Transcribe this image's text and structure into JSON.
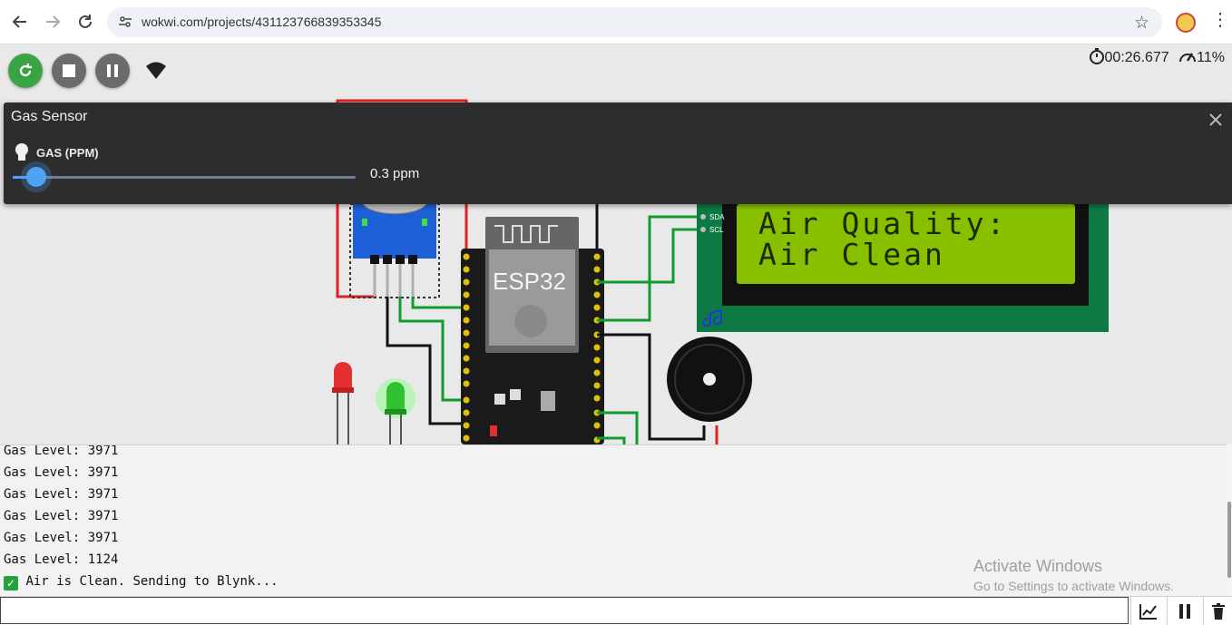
{
  "browser": {
    "url": "wokwi.com/projects/431123766839353345"
  },
  "sim": {
    "timer": "00:26.677",
    "speed": "11%",
    "chip_label": "ESP32",
    "lcd_line1": "Air Quality:",
    "lcd_line2": "Air Clean",
    "lcd_pin_sda": "SDA",
    "lcd_pin_scl": "SCL",
    "colors": {
      "lcd_green": "#88c000",
      "board_green": "#0e7a43",
      "restart_green": "#3aa445"
    }
  },
  "panel": {
    "title": "Gas Sensor",
    "control_label": "GAS (PPM)",
    "value_text": "0.3 ppm",
    "slider_fraction": 0.07
  },
  "console": {
    "lines": [
      "Gas Level: 3971",
      "Gas Level: 3971",
      "Gas Level: 3971",
      "Gas Level: 3971",
      "Gas Level: 3971",
      "Gas Level: 1124",
      "Air is Clean. Sending to Blynk..."
    ],
    "watermark_title": "Activate Windows",
    "watermark_sub": "Go to Settings to activate Windows."
  },
  "icons": {
    "back": "back-arrow-icon",
    "forward": "forward-arrow-icon",
    "reload": "reload-icon",
    "restart": "restart-icon",
    "stop": "stop-icon",
    "pause": "pause-icon",
    "wifi": "wifi-icon",
    "plotter": "chart-icon",
    "clear": "trash-icon"
  }
}
